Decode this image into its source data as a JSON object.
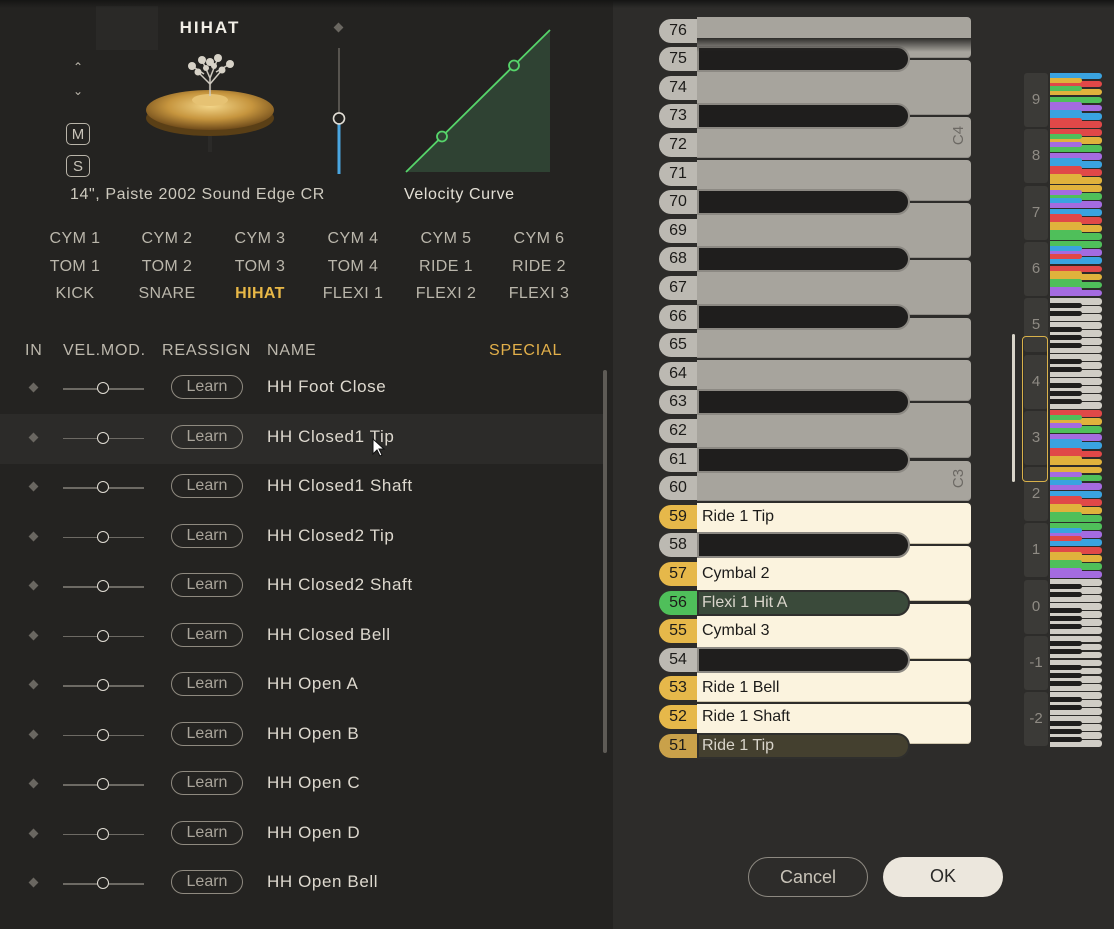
{
  "instrument": {
    "title": "HIHAT",
    "caption": "14\", Paiste 2002 Sound Edge CR",
    "velocity_label": "Velocity Curve",
    "mute_label": "M",
    "solo_label": "S",
    "volume_level": 0.6,
    "velocity_curve_points": [
      [
        0.25,
        0.25
      ],
      [
        0.75,
        0.75
      ]
    ]
  },
  "kit_grid": [
    [
      "CYM 1",
      "CYM 2",
      "CYM 3",
      "CYM 4",
      "CYM 5",
      "CYM 6"
    ],
    [
      "TOM 1",
      "TOM 2",
      "TOM 3",
      "TOM 4",
      "RIDE 1",
      "RIDE 2"
    ],
    [
      "KICK",
      "SNARE",
      "HIHAT",
      "FLEXI 1",
      "FLEXI 2",
      "FLEXI 3"
    ]
  ],
  "kit_selected": "HIHAT",
  "table": {
    "headers": {
      "in": "IN",
      "vel_mod": "VEL.MOD.",
      "reassign": "REASSIGN",
      "name": "NAME",
      "special": "SPECIAL"
    },
    "learn_label": "Learn",
    "rows": [
      "HH Foot Close",
      "HH Closed1 Tip",
      "HH Closed1 Shaft",
      "HH Closed2 Tip",
      "HH Closed2 Shaft",
      "HH Closed Bell",
      "HH Open A",
      "HH Open B",
      "HH Open C",
      "HH Open D",
      "HH Open Bell"
    ],
    "hover_row_index": 1
  },
  "keyboard": {
    "octave_labels": {
      "72": "C4",
      "60": "C3"
    },
    "keys": [
      {
        "n": "76",
        "black": false,
        "label": "",
        "color": "none"
      },
      {
        "n": "75",
        "black": true,
        "label": "",
        "color": "none"
      },
      {
        "n": "74",
        "black": false,
        "label": "",
        "color": "none"
      },
      {
        "n": "73",
        "black": true,
        "label": "",
        "color": "none"
      },
      {
        "n": "72",
        "black": false,
        "label": "",
        "color": "none"
      },
      {
        "n": "71",
        "black": false,
        "label": "",
        "color": "none"
      },
      {
        "n": "70",
        "black": true,
        "label": "",
        "color": "none"
      },
      {
        "n": "69",
        "black": false,
        "label": "",
        "color": "none"
      },
      {
        "n": "68",
        "black": true,
        "label": "",
        "color": "none"
      },
      {
        "n": "67",
        "black": false,
        "label": "",
        "color": "none"
      },
      {
        "n": "66",
        "black": true,
        "label": "",
        "color": "none"
      },
      {
        "n": "65",
        "black": false,
        "label": "",
        "color": "none"
      },
      {
        "n": "64",
        "black": false,
        "label": "",
        "color": "none"
      },
      {
        "n": "63",
        "black": true,
        "label": "",
        "color": "none"
      },
      {
        "n": "62",
        "black": false,
        "label": "",
        "color": "none"
      },
      {
        "n": "61",
        "black": true,
        "label": "",
        "color": "none"
      },
      {
        "n": "60",
        "black": false,
        "label": "",
        "color": "none"
      },
      {
        "n": "59",
        "black": false,
        "label": "Ride 1 Tip",
        "color": "gold"
      },
      {
        "n": "58",
        "black": true,
        "label": "",
        "color": "none"
      },
      {
        "n": "57",
        "black": false,
        "label": "Cymbal 2",
        "color": "gold"
      },
      {
        "n": "56",
        "black": true,
        "label": "Flexi 1 Hit A",
        "color": "green"
      },
      {
        "n": "55",
        "black": false,
        "label": "Cymbal 3",
        "color": "gold"
      },
      {
        "n": "54",
        "black": true,
        "label": "",
        "color": "none"
      },
      {
        "n": "53",
        "black": false,
        "label": "Ride 1 Bell",
        "color": "gold"
      },
      {
        "n": "52",
        "black": false,
        "label": "Ride 1 Shaft",
        "color": "gold"
      },
      {
        "n": "51",
        "black": true,
        "label": "Ride 1 Tip",
        "color": "dim"
      }
    ]
  },
  "mini_keyboard": {
    "octaves": [
      "9",
      "8",
      "7",
      "6",
      "5",
      "4",
      "3",
      "2",
      "1",
      "0",
      "-1",
      "-2"
    ],
    "colors": [
      "#3aa3e0",
      "#e04848",
      "#e0b23c",
      "#4fbf5a",
      "#a46be0"
    ]
  },
  "buttons": {
    "cancel": "Cancel",
    "ok": "OK"
  }
}
